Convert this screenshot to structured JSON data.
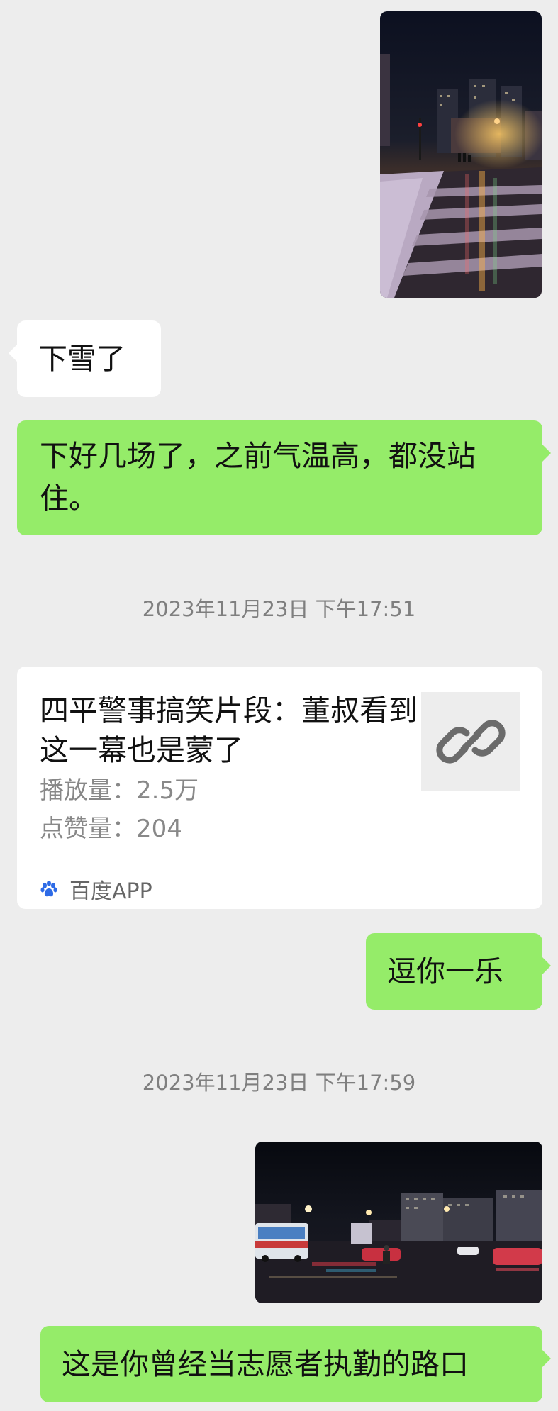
{
  "messages": {
    "snow_text": "下雪了",
    "reply_text": "下好几场了，之前气温高，都没站住。",
    "timestamp_1": "2023年11月23日 下午17:51",
    "share_card": {
      "title": "四平警事搞笑片段：董叔看到这一幕也是蒙了",
      "views_label": "播放量：",
      "views_value": "2.5万",
      "likes_label": "点赞量：",
      "likes_value": "204",
      "source": "百度APP",
      "source_icon": "baidu-paw-icon",
      "link_icon": "link-icon"
    },
    "joke_text": "逗你一乐",
    "timestamp_2": "2023年11月23日 下午17:59",
    "intersection_text": "这是你曾经当志愿者执勤的路口"
  },
  "colors": {
    "background": "#ededed",
    "bubble_green": "#95ec69",
    "bubble_white": "#ffffff",
    "timestamp": "#7f7f7f",
    "baidu_blue": "#2e6be6"
  }
}
